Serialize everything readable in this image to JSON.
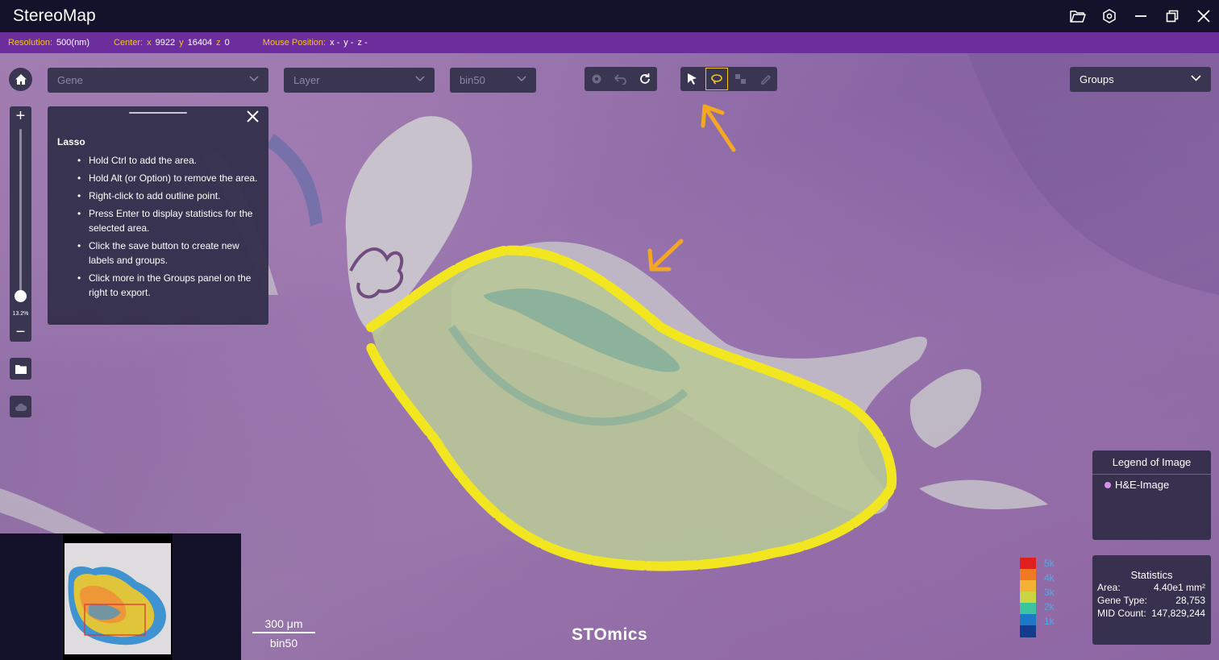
{
  "app": {
    "title": "StereoMap"
  },
  "window_controls": [
    "folder-open-icon",
    "settings-icon",
    "minimize-icon",
    "restore-icon",
    "close-icon"
  ],
  "infobar": {
    "resolution_label": "Resolution:",
    "resolution_value": "500(nm)",
    "center_label": "Center:",
    "center_x_label": "x",
    "center_x": "9922",
    "center_y_label": "y",
    "center_y": "16404",
    "center_z_label": "z",
    "center_z": "0",
    "mouse_label": "Mouse Position:",
    "mouse_x": "x -",
    "mouse_y": "y -",
    "mouse_z": "z -"
  },
  "toolbar": {
    "gene_placeholder": "Gene",
    "layer_placeholder": "Layer",
    "bin_value": "bin50",
    "groups_label": "Groups"
  },
  "zoom": {
    "percent": "13.2%",
    "level_fraction": 0.13
  },
  "lasso_panel": {
    "title": "Lasso",
    "items": [
      "Hold Ctrl to add the area.",
      "Hold Alt (or Option) to remove the area.",
      "Right-click to add outline point.",
      "Press Enter to display statistics for the selected area.",
      "Click the save button to create new labels and groups.",
      "Click more in the Groups panel on the right to export."
    ]
  },
  "scalebar": {
    "distance": "300 μm",
    "bin": "bin50"
  },
  "logo": "STOmics",
  "colorbar": {
    "labels": [
      "5k",
      "4k",
      "3k",
      "2k",
      "1k"
    ],
    "colors": [
      "#e02020",
      "#f07a20",
      "#f2b330",
      "#c9d640",
      "#3ec3a0",
      "#1e78c8",
      "#153c8c"
    ]
  },
  "legend": {
    "title": "Legend of Image",
    "item": "H&E-Image",
    "item_color": "#d78fe8"
  },
  "statistics": {
    "title": "Statistics",
    "area_label": "Area:",
    "area_value": "4.40e1 mm²",
    "gene_type_label": "Gene Type:",
    "gene_type_value": "28,753",
    "mid_count_label": "MID Count:",
    "mid_count_value": "147,829,244"
  },
  "colors": {
    "accent": "#f5c518",
    "infobar": "#6b2e9c",
    "panel": "#34304c",
    "titlebar": "#14112a"
  }
}
